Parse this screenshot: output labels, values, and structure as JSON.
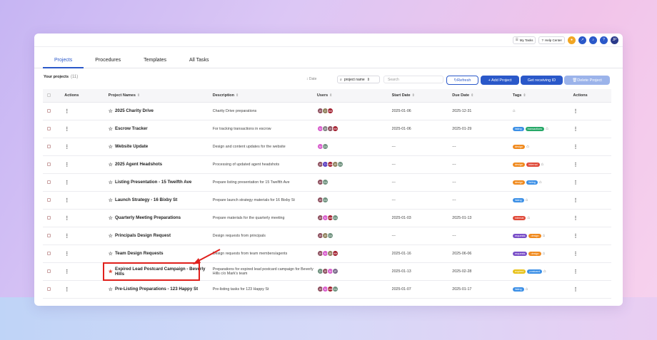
{
  "topbar": {
    "my_tasks": "My Tasks",
    "help_center": "Help Center",
    "avatar": "JP"
  },
  "tabs": [
    "Projects",
    "Procedures",
    "Templates",
    "All Tasks"
  ],
  "toolbar": {
    "your_projects": "Your projects",
    "count": "(11)",
    "date": "Date",
    "project_name_select": "project name",
    "search_placeholder": "Search",
    "refresh": "Refresh",
    "add_project": "+ Add Project",
    "get_receiving_id": "Get receiving ID",
    "delete_project": "Delete Project"
  },
  "columns": [
    "Actions",
    "Project Names",
    "Description",
    "Users",
    "Start Date",
    "Due Date",
    "Tags",
    "Actions"
  ],
  "colors": {
    "accent": "#2a58c9",
    "highlight": "#e0201c"
  },
  "rows": [
    {
      "name": "2025 Charity Drive",
      "desc": "Charity Drive preparations",
      "start": "2025-01-06",
      "due": "2025-12-31",
      "starred": false,
      "users": [
        {
          "i": "JE",
          "c": "#8a4b5a"
        },
        {
          "i": "G",
          "c": "#8e7f5a"
        },
        {
          "i": "MM",
          "c": "#a01c2c"
        }
      ],
      "tags": []
    },
    {
      "name": "Escrow Tracker",
      "desc": "For tracking transactions in escrow",
      "start": "2025-01-06",
      "due": "2025-01-29",
      "starred": false,
      "users": [
        {
          "i": "M",
          "c": "#d85ccd"
        },
        {
          "i": "JE",
          "c": "#7f7f7f"
        },
        {
          "i": "JE",
          "c": "#8a4b5a"
        },
        {
          "i": "MM",
          "c": "#a01c2c"
        }
      ],
      "tags": [
        {
          "t": "listing",
          "c": "#3b8fe6"
        },
        {
          "t": "transactions",
          "c": "#27a868"
        }
      ]
    },
    {
      "name": "Website Update",
      "desc": "Design and content updates for the website",
      "start": "---",
      "due": "---",
      "starred": false,
      "users": [
        {
          "i": "M",
          "c": "#d85ccd"
        },
        {
          "i": "DA",
          "c": "#6b8f7b"
        }
      ],
      "tags": [
        {
          "t": "design",
          "c": "#f08a1e"
        }
      ]
    },
    {
      "name": "2025 Agent Headshots",
      "desc": "Processing of updated agent headshots",
      "start": "---",
      "due": "---",
      "starred": false,
      "users": [
        {
          "i": "JE",
          "c": "#8a4b5a"
        },
        {
          "i": "TI",
          "c": "#5b3fc2"
        },
        {
          "i": "MM",
          "c": "#a01c2c"
        },
        {
          "i": "JE",
          "c": "#8e7f5a"
        },
        {
          "i": "DA",
          "c": "#6b8f7b"
        }
      ],
      "tags": [
        {
          "t": "design",
          "c": "#f08a1e"
        },
        {
          "t": "internal",
          "c": "#e04a3a"
        }
      ]
    },
    {
      "name": "Listing Presentation - 15 Twelfth Ave",
      "desc": "Prepare listing presentation for 15 Twelfth Ave",
      "start": "---",
      "due": "---",
      "starred": false,
      "users": [
        {
          "i": "JE",
          "c": "#8a4b5a"
        },
        {
          "i": "DA",
          "c": "#6b8f7b"
        }
      ],
      "tags": [
        {
          "t": "design",
          "c": "#f08a1e"
        },
        {
          "t": "listing",
          "c": "#3b8fe6"
        }
      ]
    },
    {
      "name": "Launch Strategy - 16 Bixby St",
      "desc": "Prepare launch strategy materials for 16 Bixby St",
      "start": "---",
      "due": "---",
      "starred": false,
      "users": [
        {
          "i": "JE",
          "c": "#8a4b5a"
        },
        {
          "i": "DA",
          "c": "#6b8f7b"
        }
      ],
      "tags": [
        {
          "t": "listing",
          "c": "#3b8fe6"
        }
      ]
    },
    {
      "name": "Quarterly Meeting Preparations",
      "desc": "Prepare materials for the quarterly meeting",
      "start": "2025-01-03",
      "due": "2025-01-13",
      "starred": false,
      "users": [
        {
          "i": "JE",
          "c": "#8a4b5a"
        },
        {
          "i": "M",
          "c": "#d85ccd"
        },
        {
          "i": "MM",
          "c": "#a01c2c"
        },
        {
          "i": "DA",
          "c": "#6b8f7b"
        }
      ],
      "tags": [
        {
          "t": "internal",
          "c": "#e04a3a"
        }
      ]
    },
    {
      "name": "Principals Design Request",
      "desc": "Design requests from principals",
      "start": "---",
      "due": "---",
      "starred": false,
      "users": [
        {
          "i": "JE",
          "c": "#8a4b5a"
        },
        {
          "i": "JE",
          "c": "#8e7f5a"
        },
        {
          "i": "DA",
          "c": "#6b8f7b"
        }
      ],
      "tags": [
        {
          "t": "requests",
          "c": "#7a4fc8"
        },
        {
          "t": "design",
          "c": "#f08a1e"
        }
      ]
    },
    {
      "name": "Team Design Requests",
      "desc": "Design requests from team members/agents",
      "start": "2025-01-16",
      "due": "2025-06-06",
      "starred": false,
      "users": [
        {
          "i": "JE",
          "c": "#8a4b5a"
        },
        {
          "i": "M",
          "c": "#d85ccd"
        },
        {
          "i": "JE",
          "c": "#8e7f5a"
        },
        {
          "i": "MM",
          "c": "#a01c2c"
        }
      ],
      "tags": [
        {
          "t": "requests",
          "c": "#7a4fc8"
        },
        {
          "t": "design",
          "c": "#f08a1e"
        }
      ]
    },
    {
      "name": "Expired Lead Postcard Campaign - Beverly Hills",
      "desc": "Preparations for expired lead postcard campaign for Beverly Hills c/o Mark's team",
      "start": "2025-01-13",
      "due": "2025-02-28",
      "starred": true,
      "users": [
        {
          "i": "D",
          "c": "#6b8f7b"
        },
        {
          "i": "JE",
          "c": "#8a4b5a"
        },
        {
          "i": "M",
          "c": "#d85ccd"
        },
        {
          "i": "JP",
          "c": "#7a6a8a"
        }
      ],
      "tags": [
        {
          "t": "expired",
          "c": "#e8c21a"
        },
        {
          "t": "postcard",
          "c": "#3b8fe6"
        }
      ]
    },
    {
      "name": "Pre-Listing Preparations - 123 Happy St",
      "desc": "Pre-listing tasks for 123 Happy St",
      "start": "2025-01-07",
      "due": "2025-01-17",
      "starred": false,
      "users": [
        {
          "i": "JE",
          "c": "#8a4b5a"
        },
        {
          "i": "M",
          "c": "#d85ccd"
        },
        {
          "i": "MM",
          "c": "#a01c2c"
        },
        {
          "i": "DA",
          "c": "#6b8f7b"
        }
      ],
      "tags": [
        {
          "t": "listing",
          "c": "#3b8fe6"
        }
      ]
    }
  ]
}
